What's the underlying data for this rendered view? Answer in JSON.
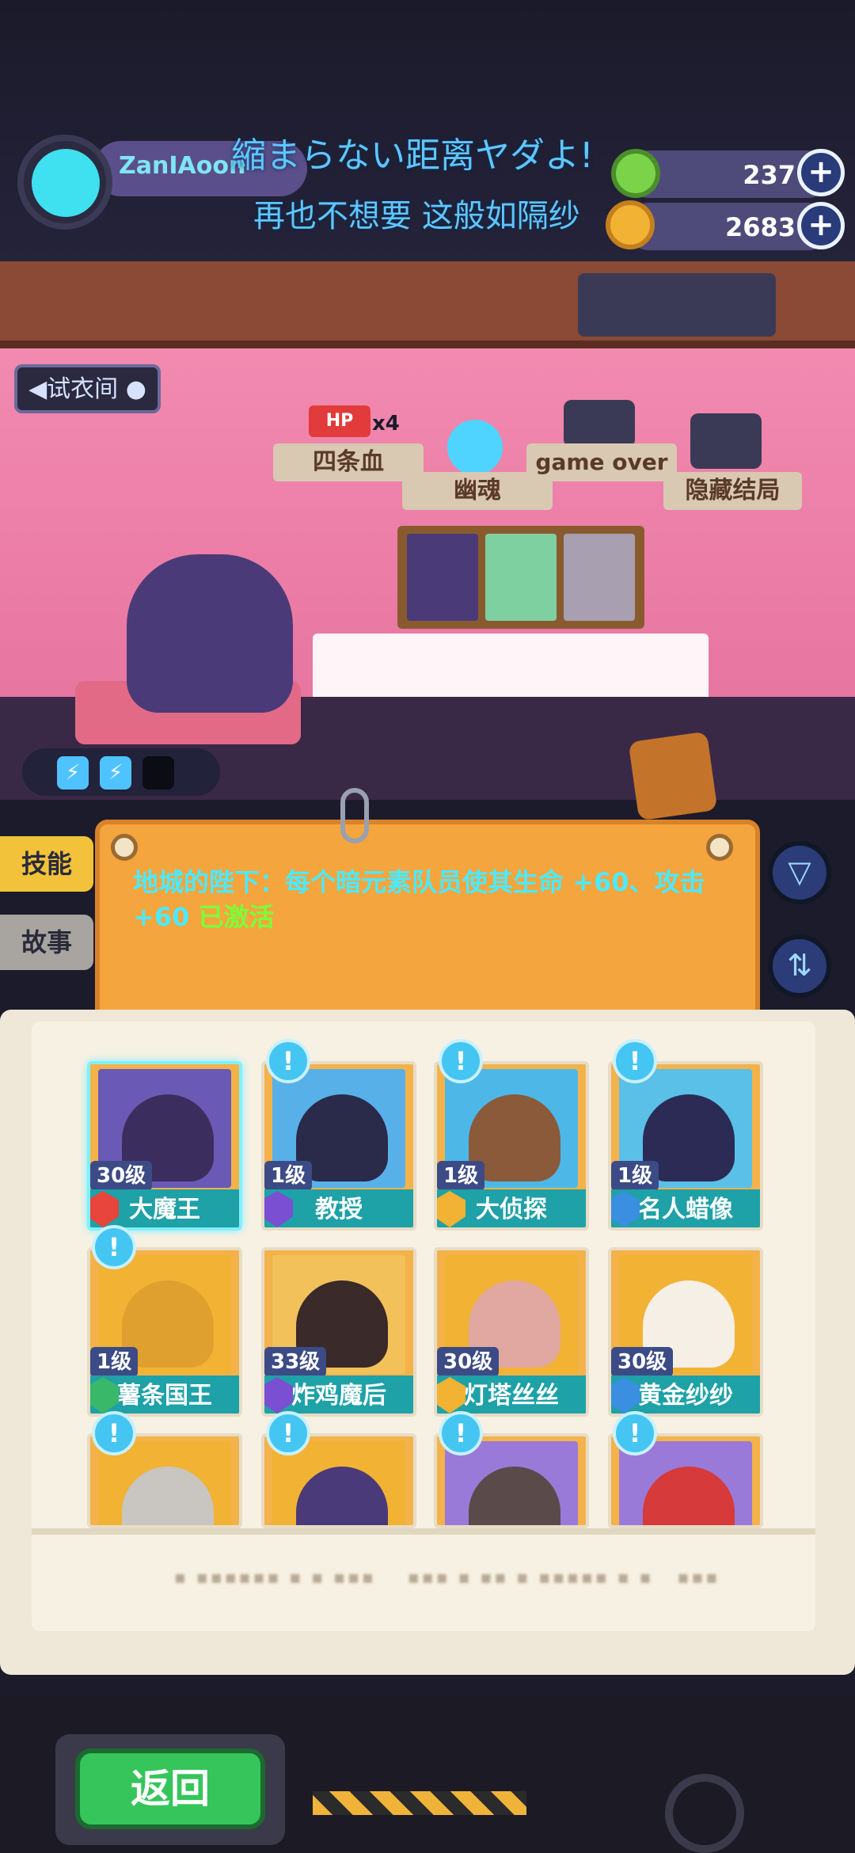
{
  "profile": {
    "name": "ZanIAoon"
  },
  "lyrics": {
    "line1": "縮まらない距离ヤダよ!",
    "line2": "再也不想要 这般如隔纱"
  },
  "currency": [
    {
      "icon": "green-donut-coin-icon",
      "value": "237",
      "color": "#7bd34a"
    },
    {
      "icon": "gold-planet-coin-icon",
      "value": "2683",
      "color": "#f2b233"
    }
  ],
  "room": {
    "trial_room_label": "◀试衣间 ●",
    "tags": [
      {
        "label": "四条血",
        "badge": "x4"
      },
      {
        "label": "幽魂"
      },
      {
        "label": "game over"
      },
      {
        "label": "隐藏结局"
      }
    ]
  },
  "side_tabs": {
    "skill": "技能",
    "story": "故事"
  },
  "skill": {
    "text": "地城的陛下：每个暗元素队员使其生命 +60、攻击 +60",
    "status": "已激活"
  },
  "colors": {
    "teal_name_strip": "#1ea1a7",
    "skill_text": "#4de9ff",
    "activated": "#7dff3a",
    "back_button": "#36c55a"
  },
  "roster": [
    {
      "level": "30级",
      "name": "大魔王",
      "rank_color": "#e8453c",
      "art": "#6a5ab5",
      "face": "#3b2e5e",
      "alert": false,
      "selected": true
    },
    {
      "level": "1级",
      "name": "教授",
      "rank_color": "#7a4fd1",
      "art": "#58b0e8",
      "face": "#2a2a4a",
      "alert": true
    },
    {
      "level": "1级",
      "name": "大侦探",
      "rank_color": "#f2b233",
      "art": "#4db8e8",
      "face": "#8a5a3a",
      "alert": true
    },
    {
      "level": "1级",
      "name": "名人蜡像",
      "rank_color": "#3a8fe0",
      "art": "#5ac0e8",
      "face": "#2b2b55",
      "alert": true
    },
    {
      "level": "1级",
      "name": "薯条国王",
      "rank_color": "#39b86a",
      "art": "#f2b233",
      "face": "#e0a030",
      "alert": true
    },
    {
      "level": "33级",
      "name": "炸鸡魔后",
      "rank_color": "#7a4fd1",
      "art": "#f2c15a",
      "face": "#3a2a2a",
      "alert": false
    },
    {
      "level": "30级",
      "name": "灯塔丝丝",
      "rank_color": "#f2b233",
      "art": "#f2b233",
      "face": "#e0a8a0",
      "alert": false
    },
    {
      "level": "30级",
      "name": "黄金纱纱",
      "rank_color": "#3a8fe0",
      "art": "#f2b233",
      "face": "#f5efe6",
      "alert": false
    },
    {
      "level": "",
      "name": "",
      "rank_color": "#39b86a",
      "art": "#f2b233",
      "face": "#c9c5c0",
      "alert": true
    },
    {
      "level": "",
      "name": "",
      "rank_color": "#7a4fd1",
      "art": "#f2b233",
      "face": "#4a3a7a",
      "alert": true
    },
    {
      "level": "",
      "name": "",
      "rank_color": "#f2b233",
      "art": "#9a7ad8",
      "face": "#5a4a4a",
      "alert": true
    },
    {
      "level": "",
      "name": "",
      "rank_color": "#3a8fe0",
      "art": "#9a7ad8",
      "face": "#d63a3a",
      "alert": true
    }
  ],
  "footer": {
    "back_label": "返回"
  }
}
